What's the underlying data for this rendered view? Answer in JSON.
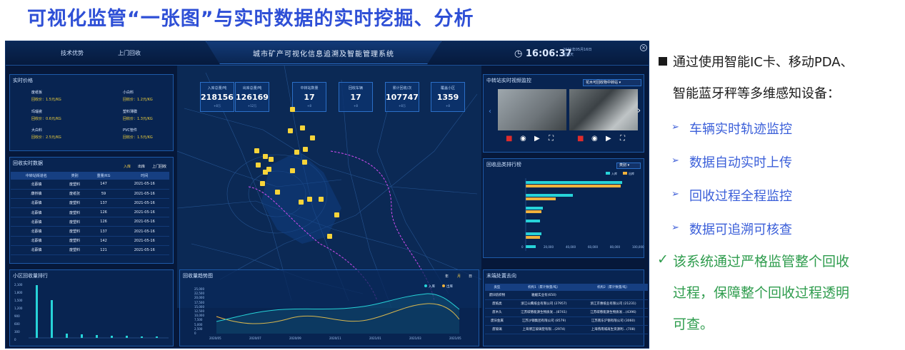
{
  "slide": {
    "title": "可视化监管“一张图”与实时数据的实时挖掘、分析"
  },
  "dashboard": {
    "tabs": [
      "技术优势",
      "上门回收"
    ],
    "system_title": "城市矿产可视化信息追溯及智能管理系统",
    "clock": "16:06:37",
    "date_line1": "2021年05月16日",
    "date_line2": "星期天",
    "stats": [
      {
        "label": "入库总量/吨",
        "value": "218156",
        "sub": "+8万"
      },
      {
        "label": "出库总量/吨",
        "value": "126169",
        "sub": "+12万"
      },
      {
        "label": "中转站数量",
        "value": "17",
        "sub": "+8"
      },
      {
        "label": "回收车辆",
        "value": "17",
        "sub": "+8"
      },
      {
        "label": "累计回收/次",
        "value": "107747",
        "sub": "+8万"
      },
      {
        "label": "覆盖小区",
        "value": "1359",
        "sub": "+8"
      }
    ],
    "prices": {
      "title": "实时价格",
      "items": [
        {
          "name": "废纸板",
          "price": "回收价：1.5元/KG"
        },
        {
          "name": "小白料",
          "price": "回收价：1.2元/KG"
        },
        {
          "name": "玛瑙瓷",
          "price": "回收价：0.6元/KG"
        },
        {
          "name": "塑料薄膜",
          "price": "回收价：1.3元/KG"
        },
        {
          "name": "大白料",
          "price": "回收价：2.5元/KG"
        },
        {
          "name": "PVC管件",
          "price": "回收价：1.5元/KG"
        }
      ]
    },
    "realtime": {
      "title": "回收实时数据",
      "filters": [
        "入库",
        "出库",
        "上门回收"
      ],
      "headers": [
        "中转站街道名",
        "类别",
        "重量/KG",
        "时间"
      ],
      "rows": [
        [
          "北蔡镇",
          "废塑料",
          "147",
          "2021-05-16"
        ],
        [
          "康桥镇",
          "废纸张",
          "59",
          "2021-05-16"
        ],
        [
          "北蔡镇",
          "废塑料",
          "137",
          "2021-05-16"
        ],
        [
          "北蔡镇",
          "废塑料",
          "126",
          "2021-05-16"
        ],
        [
          "北蔡镇",
          "废塑料",
          "126",
          "2021-05-16"
        ],
        [
          "北蔡镇",
          "废塑料",
          "137",
          "2021-05-16"
        ],
        [
          "北蔡镇",
          "废塑料",
          "142",
          "2021-05-16"
        ],
        [
          "北蔡镇",
          "废塑料",
          "121",
          "2021-05-16"
        ]
      ]
    },
    "video": {
      "title": "中转站实时视频监控",
      "select": "花木可回收物中转站"
    },
    "category_rank": {
      "title": "回收品类排行榜",
      "select": "类别",
      "legend": [
        "入库",
        "出库"
      ],
      "x_ticks": [
        "0",
        "20,000",
        "40,000",
        "60,000",
        "80,000",
        "100,000"
      ]
    },
    "community_rank": {
      "title": "小区回收量排行",
      "y_ticks": [
        "2,100",
        "1,800",
        "1,500",
        "1,200",
        "900",
        "600",
        "300",
        "0"
      ]
    },
    "trend": {
      "title": "回收量趋势图",
      "toggles": [
        "年",
        "月",
        "日"
      ],
      "legend": [
        "入库",
        "出库"
      ],
      "y_ticks": [
        "25,000",
        "22,500",
        "20,000",
        "17,500",
        "15,000",
        "12,500",
        "10,000",
        "7,500",
        "5,000",
        "2,500",
        "0"
      ],
      "x_ticks": [
        "2020/05",
        "2020/07",
        "2020/09",
        "2020/11",
        "2021/01",
        "2021/03",
        "2021/05"
      ]
    },
    "destination": {
      "title": "末端处置去向",
      "headers": [
        "类型",
        "机构1（累计数量/吨）",
        "机构2（累计数量/吨）"
      ],
      "rows": [
        [
          "废旧纺织物",
          "雅媛实业有(650)",
          ""
        ],
        [
          "废纸类",
          "浙江山鹰纸业有限公司 (27957)",
          "浙江京惠纸业有限公司 (21231)"
        ],
        [
          "废木头",
          "江苏碳慈能源生物质发…(8741)",
          "江苏碳慈能源生物质发…(4396)"
        ],
        [
          "废旧金属",
          "江苏沙钢集团有限公司 (8579)",
          "江苏南东沪钢有限公司 (3060)"
        ],
        [
          "废玻璃",
          "上海博正玻璃登有限…(2974)",
          "上海燕南城再生资源利…(708)"
        ]
      ]
    }
  },
  "bullets": {
    "main_line1": "通过使用智能IC卡、移动PDA、",
    "main_line2": "智能蓝牙秤等多维感知设备：",
    "items": [
      "车辆实时轨迹监控",
      "数据自动实时上传",
      "回收过程全程监控",
      "数据可追溯可核查"
    ],
    "summary_line1": "该系统通过严格监管整个回收",
    "summary_line2": "过程，保障整个回收过程透明",
    "summary_line3": "可查。"
  },
  "colors": {
    "title_blue": "#2e4fd6",
    "item_blue": "#3b5fd9",
    "summary_green": "#2e9c4d",
    "dash_bg": "#06183a",
    "cyan": "#27d3d8",
    "orange": "#f0b23c"
  }
}
